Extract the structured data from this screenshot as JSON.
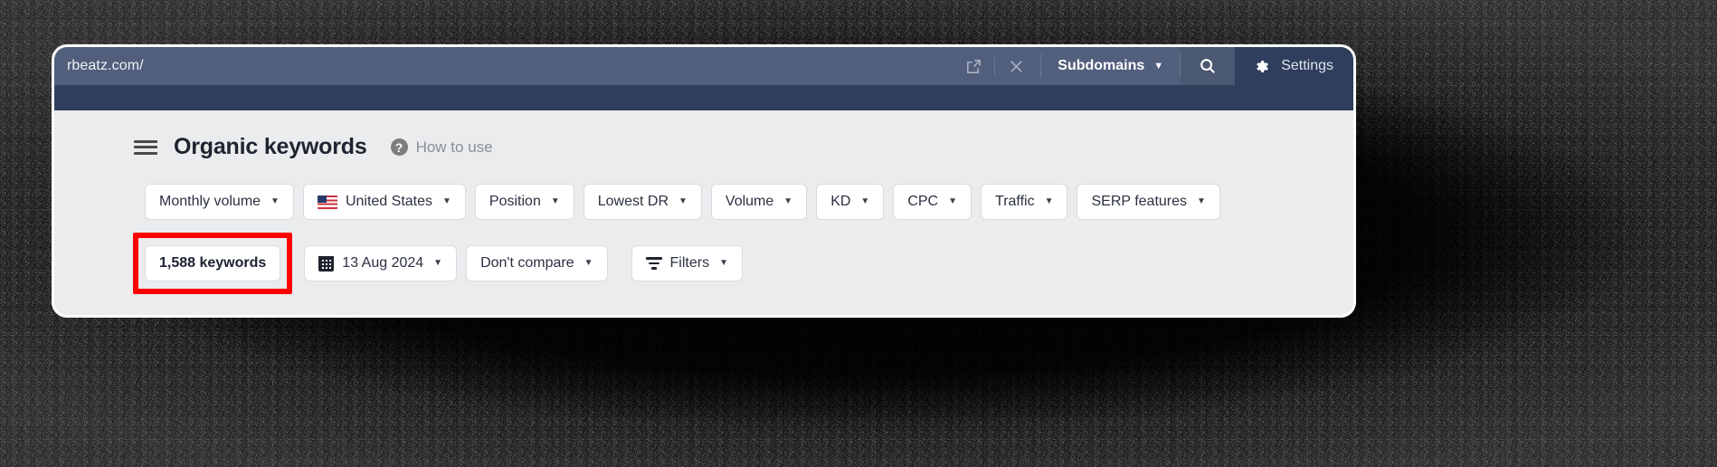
{
  "urlbar": {
    "url": "rbeatz.com/",
    "open_in_new_tab_icon": "external-link-icon",
    "close_icon": "close-icon",
    "scope_label": "Subdomains",
    "search_icon": "search-icon",
    "settings_label": "Settings",
    "gear_icon": "gear-icon",
    "caret": "▼",
    "colors": {
      "bar_bg": "#515f7d",
      "subband_bg": "#2f3e5c",
      "settings_bg": "#2f3e5c",
      "search_bg": "#4b5872"
    }
  },
  "header": {
    "menu_icon": "hamburger-menu-icon",
    "title": "Organic keywords",
    "help_icon": "question-mark-icon",
    "help_glyph": "?",
    "how_to_use": "How to use"
  },
  "filters": {
    "caret": "▼",
    "items": [
      {
        "label": "Monthly volume",
        "icon": null
      },
      {
        "label": "United States",
        "icon": "us-flag-icon"
      },
      {
        "label": "Position",
        "icon": null
      },
      {
        "label": "Lowest DR",
        "icon": null
      },
      {
        "label": "Volume",
        "icon": null
      },
      {
        "label": "KD",
        "icon": null
      },
      {
        "label": "CPC",
        "icon": null
      },
      {
        "label": "Traffic",
        "icon": null
      },
      {
        "label": "SERP features",
        "icon": null
      }
    ]
  },
  "meta_row": {
    "keyword_count": "1,588 keywords",
    "date": "13 Aug 2024",
    "date_icon": "calendar-icon",
    "compare": "Don't compare",
    "filters_label": "Filters",
    "filters_icon": "filter-icon",
    "caret": "▼",
    "highlight_color": "#ff0000"
  }
}
